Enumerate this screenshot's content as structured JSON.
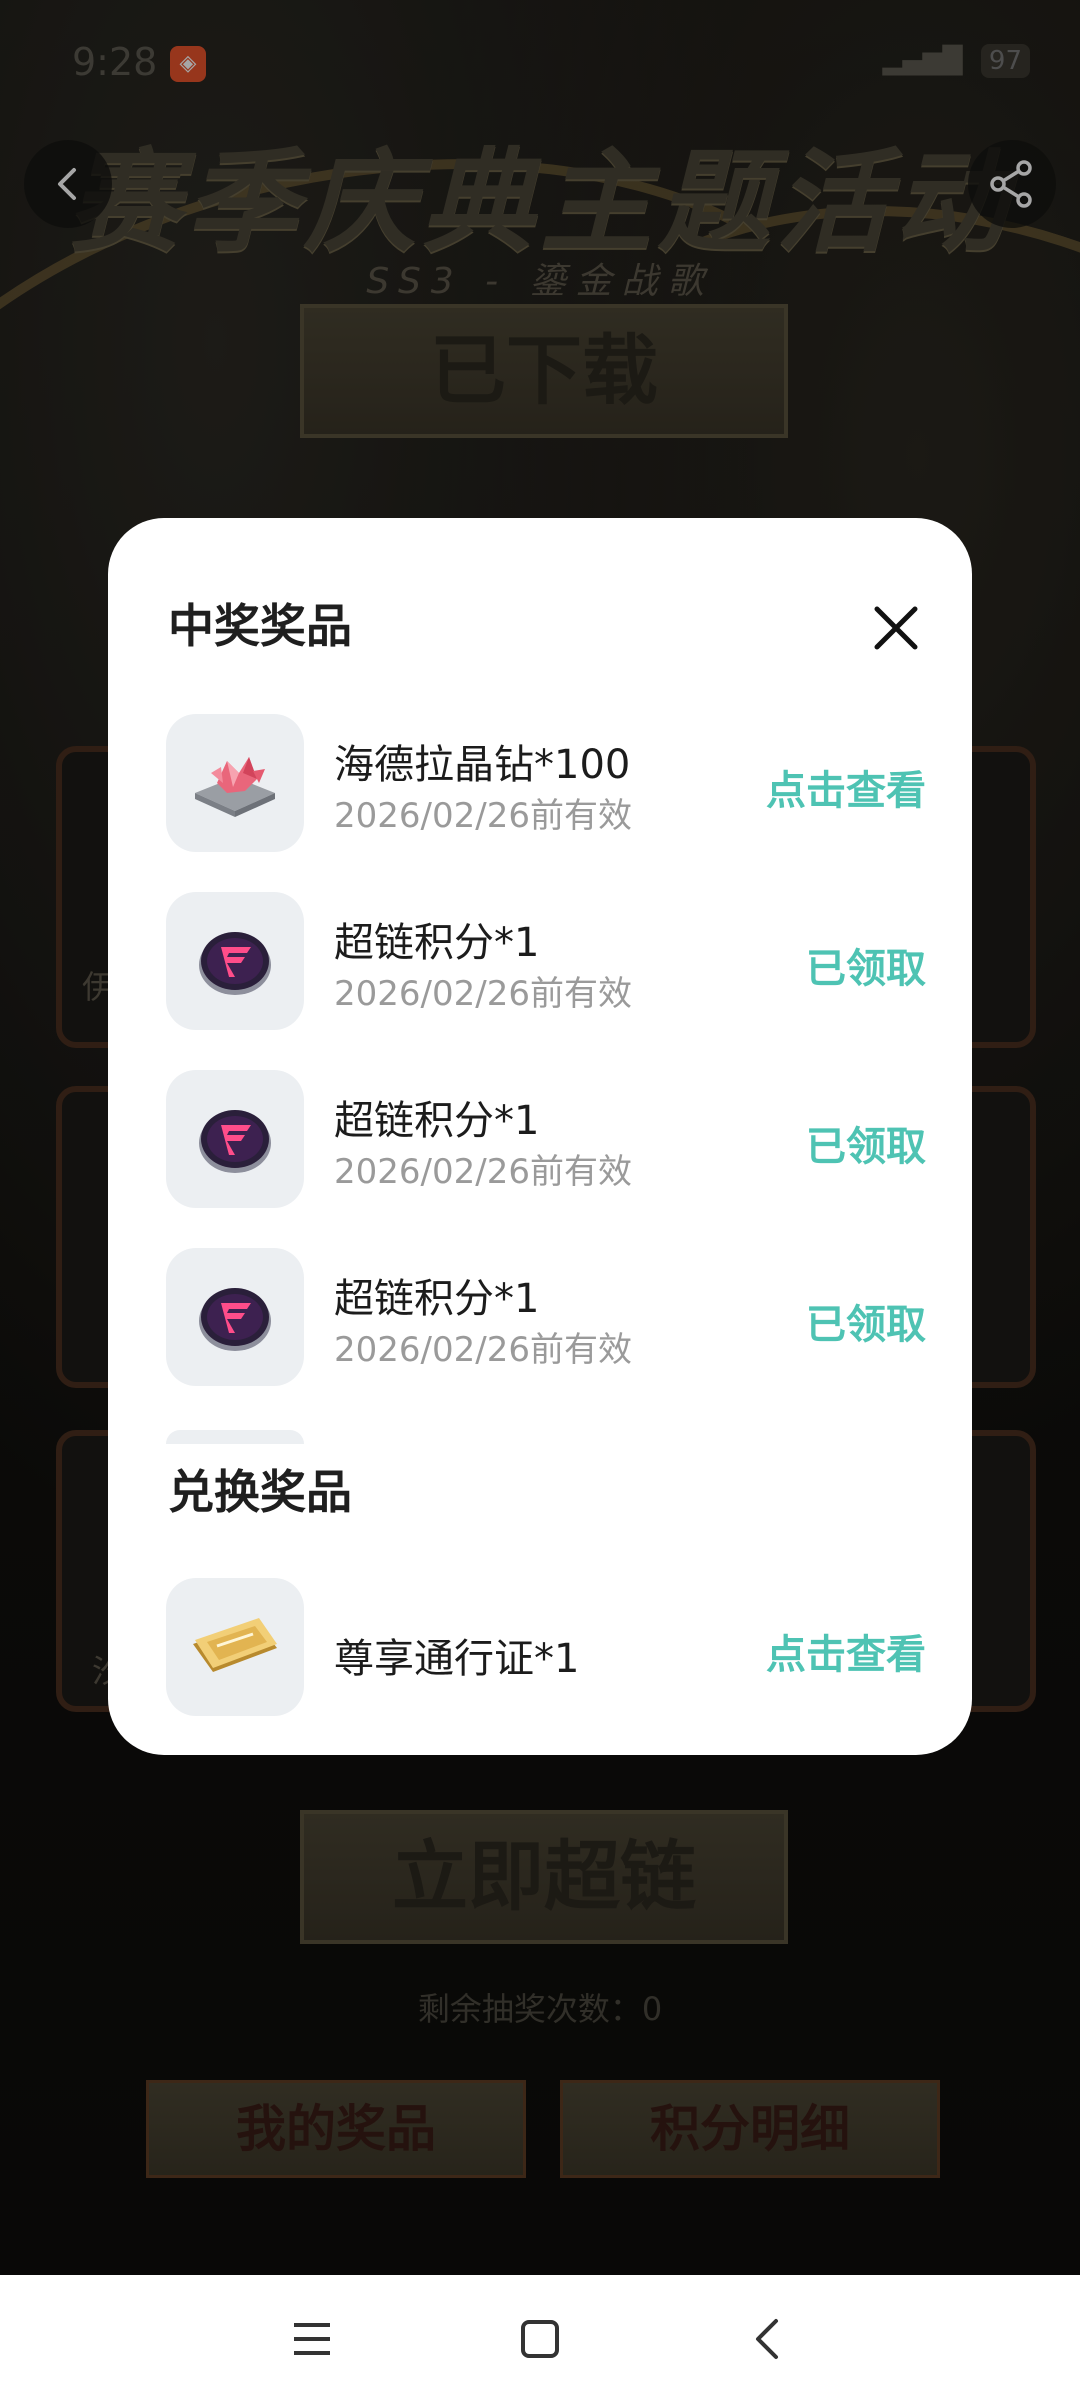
{
  "status_bar": {
    "time": "9:28",
    "battery": "97"
  },
  "event": {
    "title": "赛季庆典主题活动",
    "subtitle": "SS3 - 鎏金战歌",
    "downloaded_label": "已下载",
    "lottery_label": "立即超链",
    "remaining_draws": "剩余抽奖次数：0",
    "my_prizes_label": "我的奖品",
    "points_detail_label": "积分明细",
    "card_chars": [
      "伊",
      "汐"
    ]
  },
  "modal": {
    "won_section_title": "中奖奖品",
    "won_prizes": [
      {
        "name": "海德拉晶钻*100",
        "valid": "2026/02/26前有效",
        "action": "点击查看",
        "icon": "crystal-diamond-icon"
      },
      {
        "name": "超链积分*1",
        "valid": "2026/02/26前有效",
        "action": "已领取",
        "icon": "superlink-coin-icon"
      },
      {
        "name": "超链积分*1",
        "valid": "2026/02/26前有效",
        "action": "已领取",
        "icon": "superlink-coin-icon"
      },
      {
        "name": "超链积分*1",
        "valid": "2026/02/26前有效",
        "action": "已领取",
        "icon": "superlink-coin-icon"
      }
    ],
    "exchange_section_title": "兑换奖品",
    "exchange_prizes": [
      {
        "name": "尊享通行证*1",
        "action": "点击查看",
        "icon": "gold-ticket-icon"
      }
    ]
  },
  "colors": {
    "accent": "#4ec3b3",
    "modal_bg": "#ffffff",
    "thumb_bg": "#eceff2"
  }
}
